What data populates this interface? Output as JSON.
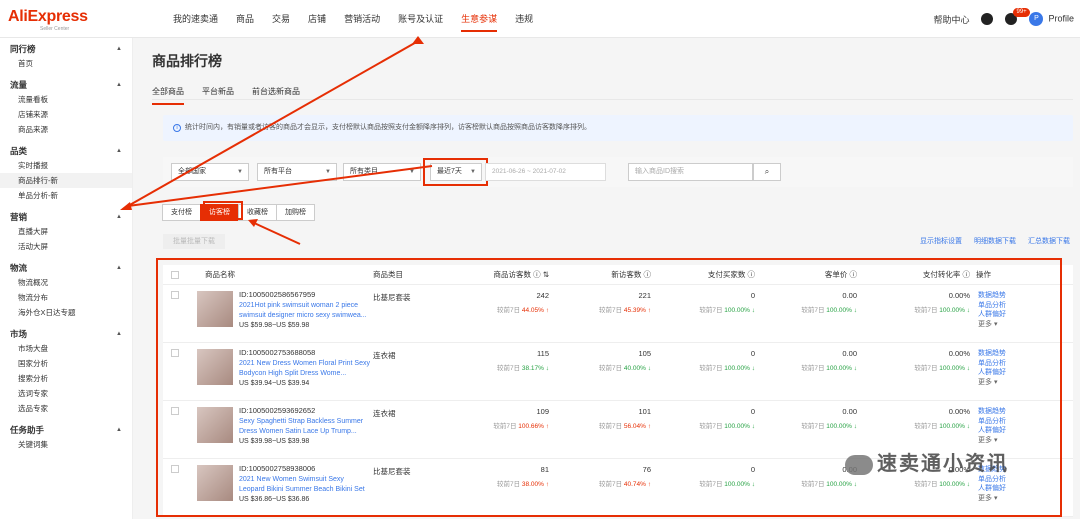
{
  "brand": {
    "logo": "AliExpress",
    "sub": "Seller Center"
  },
  "nav": [
    "我的速卖通",
    "商品",
    "交易",
    "店铺",
    "营销活动",
    "账号及认证",
    "生意参谋",
    "违规"
  ],
  "nav_active": 6,
  "top_right": {
    "help": "帮助中心",
    "badge": "99+",
    "profile": "Profile"
  },
  "sidebar": [
    {
      "title": "同行榜",
      "items": [
        "首页"
      ]
    },
    {
      "title": "流量",
      "items": [
        "流量看板",
        "店铺来源",
        "商品来源"
      ]
    },
    {
      "title": "品类",
      "items": [
        "实时播报",
        "商品排行-新",
        "单品分析-新"
      ]
    },
    {
      "title": "营销",
      "items": [
        "直播大屏",
        "活动大屏"
      ]
    },
    {
      "title": "物流",
      "items": [
        "物流概况",
        "物流分布",
        "海外仓X日达专题"
      ]
    },
    {
      "title": "市场",
      "items": [
        "市场大盘",
        "国家分析",
        "搜索分析",
        "选词专家",
        "选品专家"
      ]
    },
    {
      "title": "任务助手",
      "items": [
        "关键词集"
      ]
    }
  ],
  "page_title": "商品排行榜",
  "tabs": [
    "全部商品",
    "平台新品",
    "前台选新商品"
  ],
  "notice": "统计时间内，有销量或者访客的商品才会显示，支付榜默认商品按照支付金额降序排列，访客榜默认商品按照商品访客数降序排列。",
  "filters": {
    "country": "全部国家",
    "platform": "所有平台",
    "category": "所有类目",
    "period": "最近7天",
    "daterange": "2021-06-26 ~ 2021-07-02",
    "search_placeholder": "输入商品ID搜索"
  },
  "rank_buttons": [
    "支付榜",
    "访客榜",
    "收藏榜",
    "加购榜"
  ],
  "rank_active": 1,
  "download_button": "批量批量下载",
  "links": [
    "显示指标设置",
    "明细数据下载",
    "汇总数据下载"
  ],
  "headers": [
    "商品名称",
    "商品类目",
    "商品访客数 ⓘ ⇅",
    "新访客数 ⓘ",
    "支付买家数 ⓘ",
    "客单价 ⓘ",
    "支付转化率 ⓘ",
    "操作"
  ],
  "compare_label": "较前7日",
  "ops": [
    "数据趋势",
    "单品分析",
    "人群偏好"
  ],
  "more": "更多 ▾",
  "rows": [
    {
      "id": "ID:1005002586567959",
      "title": "2021Hot pink swimsuit woman 2 piece swimsuit designer micro sexy swimwea...",
      "price": "US $59.98~US $59.98",
      "cat": "比基尼套装",
      "visitors": "242",
      "v_cmp": "44.05% ↑",
      "v_dir": "up",
      "newv": "221",
      "n_cmp": "45.39% ↑",
      "n_dir": "up",
      "buyers": "0",
      "b_cmp": "100.00% ↓",
      "aov": "0.00",
      "a_cmp": "100.00% ↓",
      "cr": "0.00%",
      "c_cmp": "100.00% ↓"
    },
    {
      "id": "ID:1005002753688058",
      "title": "2021 New Dress Women Floral Print Sexy Bodycon High Split Dress Wome...",
      "price": "US $39.94~US $39.94",
      "cat": "连衣裙",
      "visitors": "115",
      "v_cmp": "38.17% ↓",
      "v_dir": "down",
      "newv": "105",
      "n_cmp": "40.00% ↓",
      "n_dir": "down",
      "buyers": "0",
      "b_cmp": "100.00% ↓",
      "aov": "0.00",
      "a_cmp": "100.00% ↓",
      "cr": "0.00%",
      "c_cmp": "100.00% ↓"
    },
    {
      "id": "ID:1005002593692652",
      "title": "Sexy Spaghetti Strap Backless Summer Dress Women Satin Lace Up Trump...",
      "price": "US $39.98~US $39.98",
      "cat": "连衣裙",
      "visitors": "109",
      "v_cmp": "100.66% ↑",
      "v_dir": "up",
      "newv": "101",
      "n_cmp": "56.04% ↑",
      "n_dir": "up",
      "buyers": "0",
      "b_cmp": "100.00% ↓",
      "aov": "0.00",
      "a_cmp": "100.00% ↓",
      "cr": "0.00%",
      "c_cmp": "100.00% ↓"
    },
    {
      "id": "ID:1005002758938006",
      "title": "2021 New Women Swimsuit Sexy Leopard Bikini Summer Beach Bikini Set L...",
      "price": "US $36.86~US $36.86",
      "cat": "比基尼套装",
      "visitors": "81",
      "v_cmp": "38.00% ↑",
      "v_dir": "up",
      "newv": "76",
      "n_cmp": "40.74% ↑",
      "n_dir": "up",
      "buyers": "0",
      "b_cmp": "100.00% ↓",
      "aov": "0.00",
      "a_cmp": "100.00% ↓",
      "cr": "0.00%",
      "c_cmp": "100.00% ↓"
    }
  ],
  "watermark": "速卖通小资讯"
}
